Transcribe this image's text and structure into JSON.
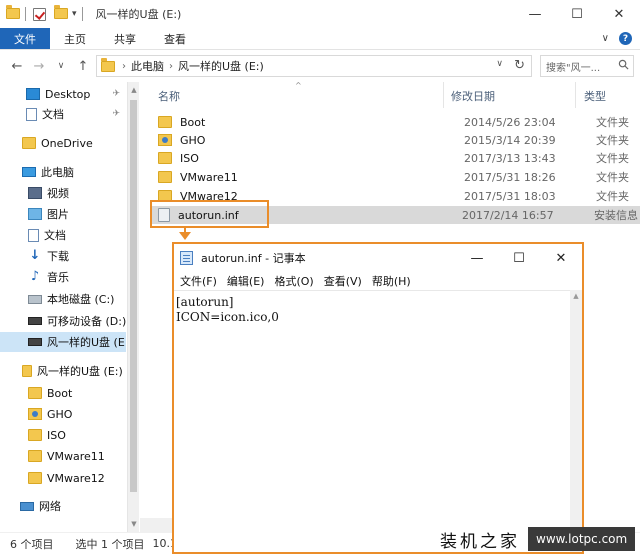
{
  "window": {
    "title": "风一样的U盘 (E:)",
    "controls": {
      "minimize": "—",
      "maximize": "☐",
      "close": "✕"
    }
  },
  "ribbon": {
    "tabs": [
      "文件",
      "主页",
      "共享",
      "查看"
    ],
    "expand": "∨",
    "help": "?"
  },
  "address": {
    "breadcrumbs": [
      "此电脑",
      "风一样的U盘 (E:)"
    ],
    "search_placeholder": "搜索\"风一..."
  },
  "sidebar": {
    "items": [
      {
        "label": "Desktop",
        "icon": "desktop-icon",
        "pinned": true
      },
      {
        "label": "文档",
        "icon": "document-icon",
        "pinned": true
      },
      {
        "label": "OneDrive",
        "icon": "onedrive-icon"
      },
      {
        "label": "此电脑",
        "icon": "this-pc-icon"
      },
      {
        "label": "视频",
        "icon": "video-icon"
      },
      {
        "label": "图片",
        "icon": "picture-icon"
      },
      {
        "label": "文档",
        "icon": "document-icon"
      },
      {
        "label": "下载",
        "icon": "download-icon"
      },
      {
        "label": "音乐",
        "icon": "music-icon"
      },
      {
        "label": "本地磁盘 (C:)",
        "icon": "drive-icon"
      },
      {
        "label": "可移动设备 (D:)",
        "icon": "usb-drive-icon"
      },
      {
        "label": "风一样的U盘 (E:",
        "icon": "usb-drive-icon",
        "selected": true
      },
      {
        "label": "风一样的U盘 (E:)",
        "icon": "usb-drive-icon"
      },
      {
        "label": "Boot",
        "icon": "folder-icon"
      },
      {
        "label": "GHO",
        "icon": "folder-icon"
      },
      {
        "label": "ISO",
        "icon": "folder-icon"
      },
      {
        "label": "VMware11",
        "icon": "folder-icon"
      },
      {
        "label": "VMware12",
        "icon": "folder-icon"
      },
      {
        "label": "网络",
        "icon": "network-icon"
      }
    ]
  },
  "filelist": {
    "columns": {
      "name": "名称",
      "date": "修改日期",
      "type": "类型"
    },
    "rows": [
      {
        "name": "Boot",
        "date": "2014/5/26 23:04",
        "type": "文件夹",
        "icon": "folder-icon"
      },
      {
        "name": "GHO",
        "date": "2015/3/14 20:39",
        "type": "文件夹",
        "icon": "folder-icon"
      },
      {
        "name": "ISO",
        "date": "2017/3/13 13:43",
        "type": "文件夹",
        "icon": "folder-icon"
      },
      {
        "name": "VMware11",
        "date": "2017/5/31 18:26",
        "type": "文件夹",
        "icon": "folder-icon"
      },
      {
        "name": "VMware12",
        "date": "2017/5/31 18:03",
        "type": "文件夹",
        "icon": "folder-icon"
      },
      {
        "name": "autorun.inf",
        "date": "2017/2/14 16:57",
        "type": "安装信息",
        "icon": "inf-file-icon",
        "selected": true
      }
    ]
  },
  "status": {
    "count": "6 个项目",
    "selected": "选中 1 个项目",
    "size": "10.1"
  },
  "notepad": {
    "title": "autorun.inf - 记事本",
    "controls": {
      "minimize": "—",
      "maximize": "☐",
      "close": "✕"
    },
    "menu": [
      "文件(F)",
      "编辑(E)",
      "格式(O)",
      "查看(V)",
      "帮助(H)"
    ],
    "content": "[autorun]\nICON=icon.ico,0"
  },
  "watermark": {
    "brand": "装机之家",
    "url": "www.lotpc.com"
  },
  "colors": {
    "accent": "#1f66b8",
    "highlight": "#ea8d2a",
    "selection": "#cce4f7",
    "folder": "#f3c74e"
  }
}
